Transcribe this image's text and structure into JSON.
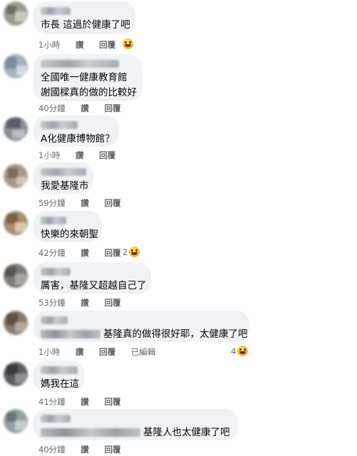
{
  "comments": [
    {
      "text": "市長 這過於健康了吧",
      "time": "1小時",
      "like": "讚",
      "reply": "回覆"
    },
    {
      "text_line1": "全國唯一健康教育館",
      "text_line2": "謝國樑真的做的比較好",
      "time": "40分鐘",
      "like": "讚",
      "reply": "回覆"
    },
    {
      "text": "A化健康博物館？",
      "time": "1小時",
      "like": "讚",
      "reply": "回覆"
    },
    {
      "text": "我愛基隆市",
      "time": "59分鐘",
      "like": "讚",
      "reply": "回覆"
    },
    {
      "text": "快樂的來朝聖",
      "time": "42分鐘",
      "like": "讚",
      "reply": "回覆",
      "reaction_count": "2"
    },
    {
      "text": "厲害，基隆又超越自己了",
      "time": "53分鐘",
      "like": "讚",
      "reply": "回覆"
    },
    {
      "text": "基隆真的做得很好耶，太健康了吧",
      "time": "1小時",
      "like": "讚",
      "reply": "回覆",
      "edited": "已編輯",
      "reaction_count": "4"
    },
    {
      "text": "媽我在這",
      "time": "41分鐘",
      "like": "讚",
      "reply": "回覆"
    },
    {
      "text": "基隆人也太健康了吧",
      "time": "40分鐘",
      "like": "讚",
      "reply": "回覆"
    }
  ],
  "icons": {
    "reaction": "grinning-face-emoji"
  }
}
